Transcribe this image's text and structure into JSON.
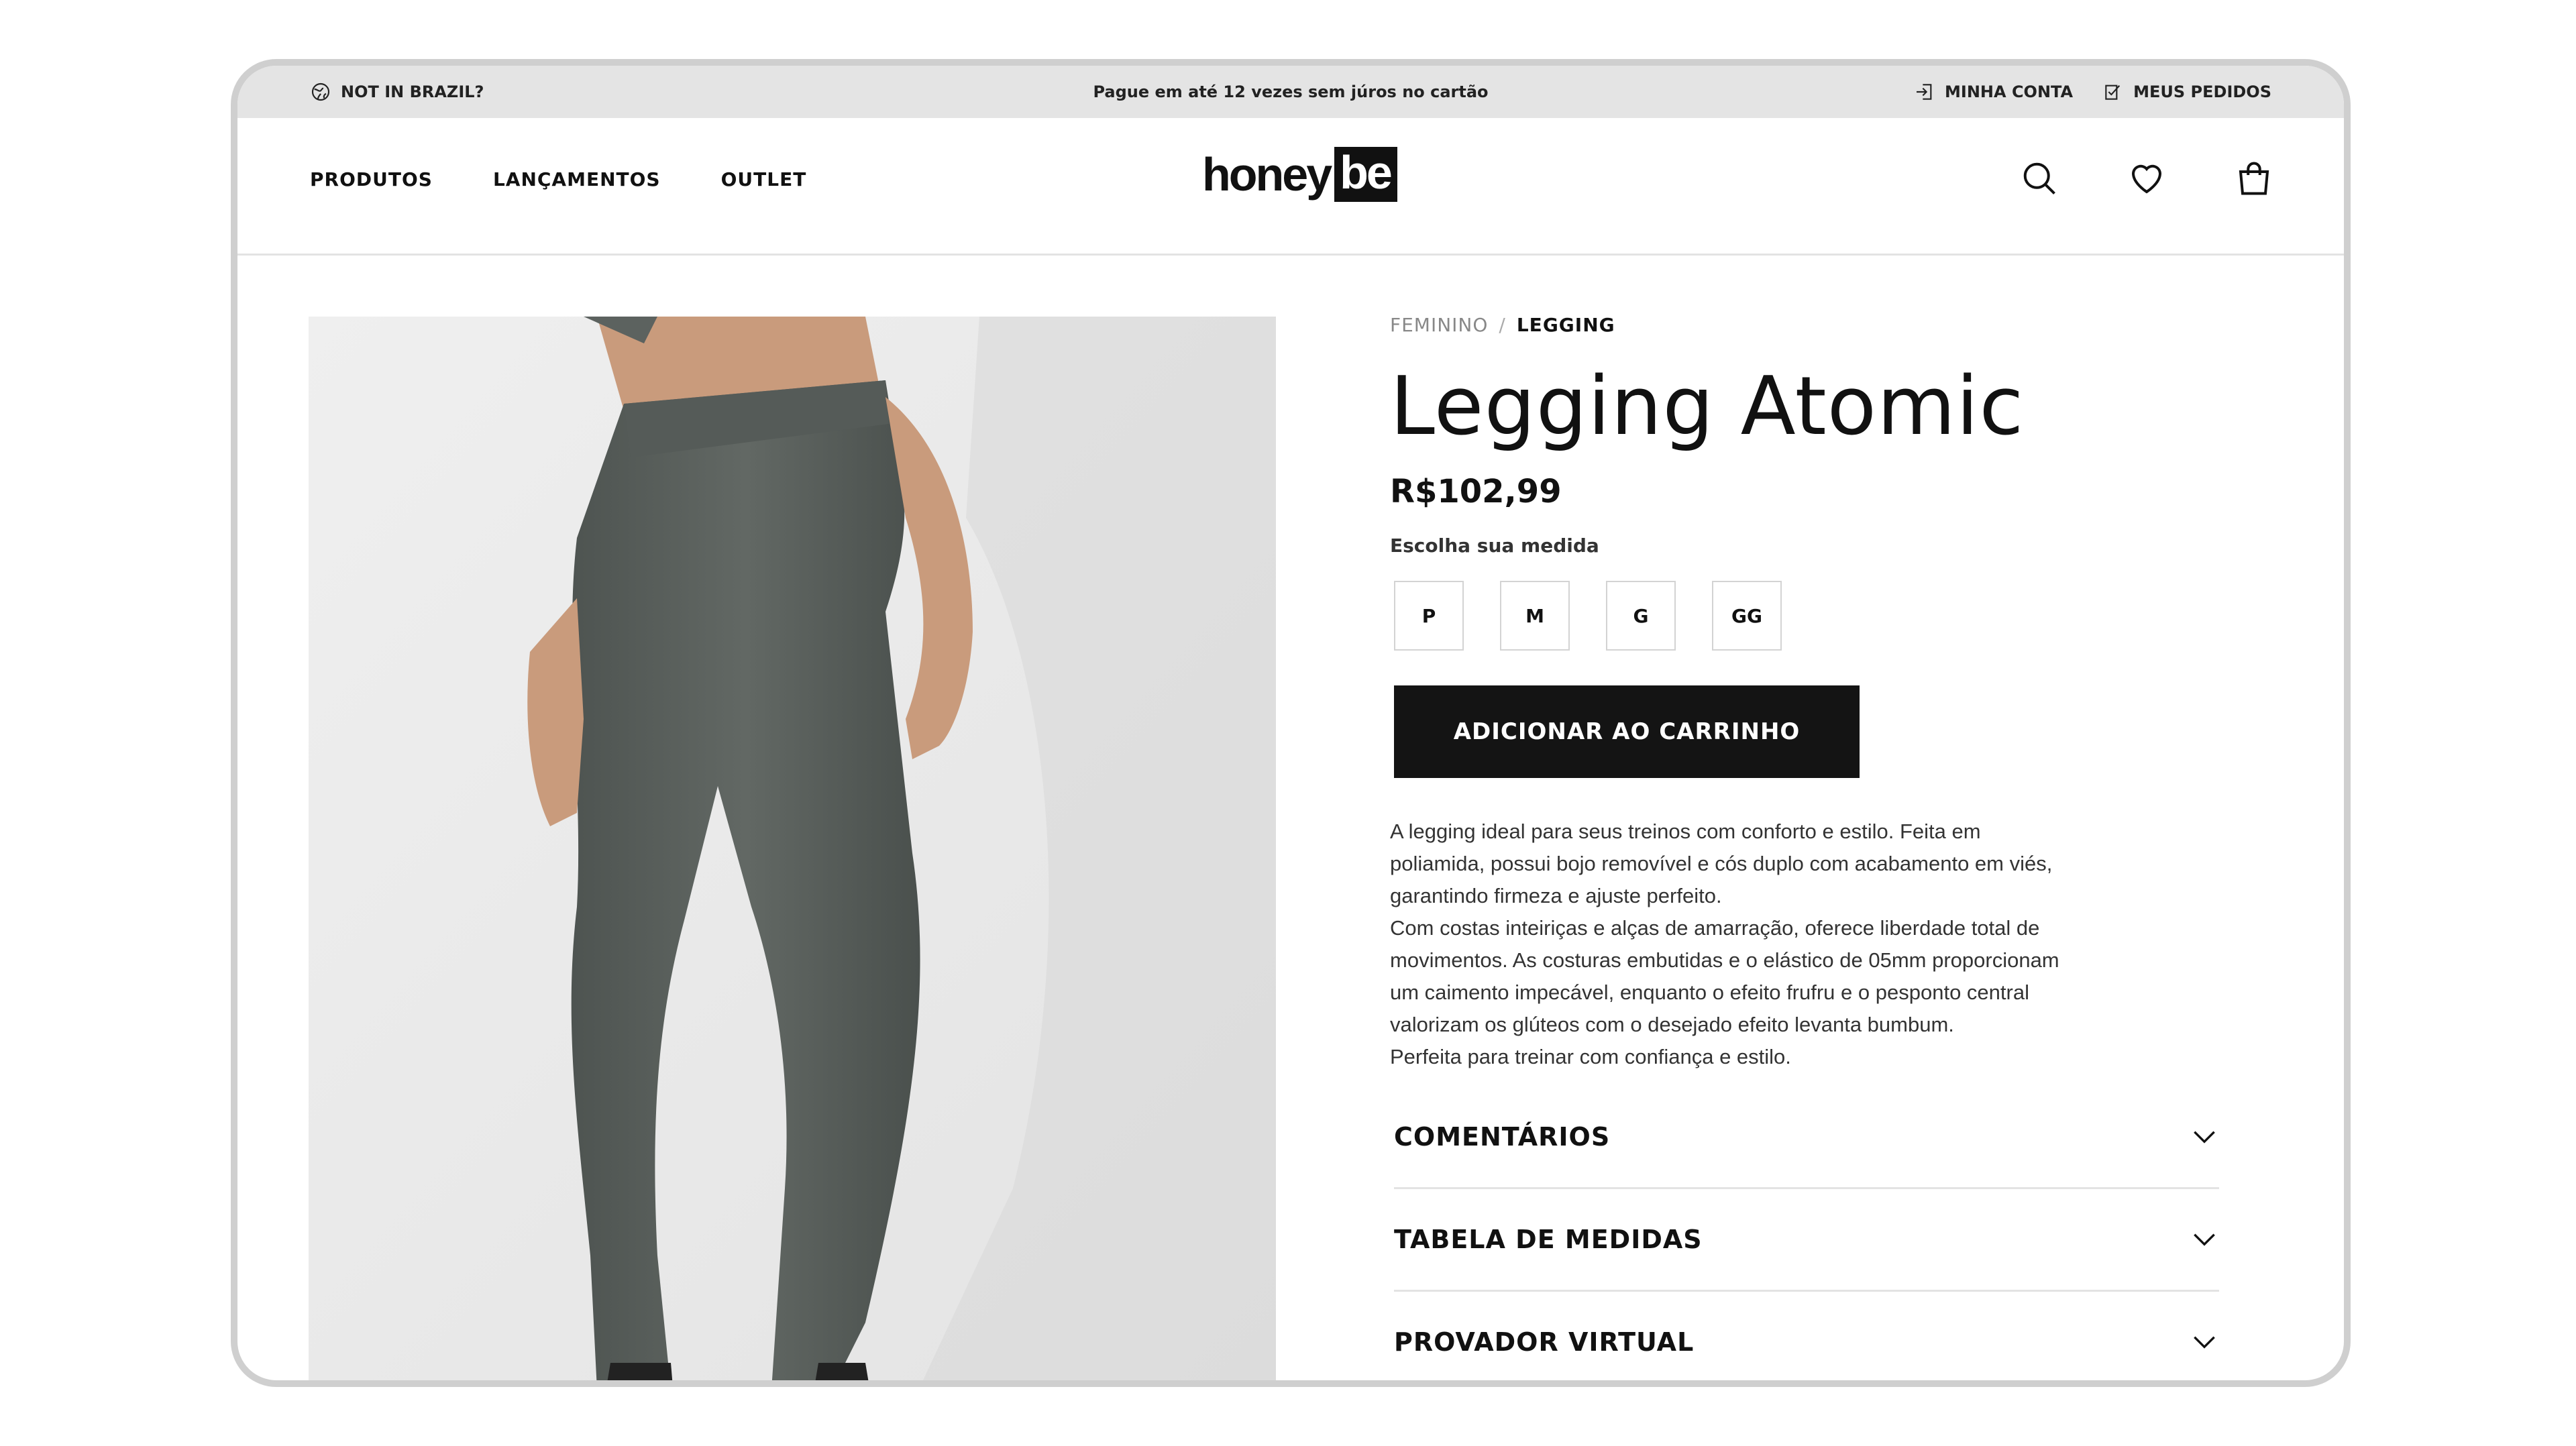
{
  "topbar": {
    "region": "NOT IN BRAZIL?",
    "promo": "Pague em até 12 vezes sem júros no cartão",
    "account": "MINHA CONTA",
    "orders": "MEUS PEDIDOS"
  },
  "nav": {
    "items": [
      "PRODUTOS",
      "LANÇAMENTOS",
      "OUTLET"
    ]
  },
  "logo": {
    "honey": "honey",
    "be": "be"
  },
  "header_icons": [
    "search-icon",
    "heart-icon",
    "shopping-bag-icon"
  ],
  "breadcrumb": {
    "parent": "FEMININO",
    "separator": "/",
    "current": "LEGGING"
  },
  "product": {
    "title": "Legging Atomic",
    "price": "R$102,99",
    "size_label": "Escolha sua medida",
    "sizes": [
      "P",
      "M",
      "G",
      "GG"
    ],
    "add_to_cart": "ADICIONAR AO CARRINHO",
    "description": [
      "A legging ideal para seus treinos com conforto e estilo. Feita em poliamida, possui bojo removível e cós duplo com acabamento em viés, garantindo firmeza e ajuste perfeito.",
      "Com costas inteiriças e alças de amarração, oferece liberdade total de movimentos. As costuras embutidas e o elástico de 05mm proporcionam um caimento impecável, enquanto o efeito frufru e o pesponto central valorizam os glúteos com o desejado efeito levanta bumbum.",
      "Perfeita para treinar com confiança e estilo."
    ]
  },
  "accordions": [
    "COMENTÁRIOS",
    "TABELA DE MEDIDAS",
    "PROVADOR VIRTUAL"
  ],
  "colors": {
    "legging": "#5a605c",
    "button": "#141414",
    "topbar": "#e4e4e4"
  }
}
